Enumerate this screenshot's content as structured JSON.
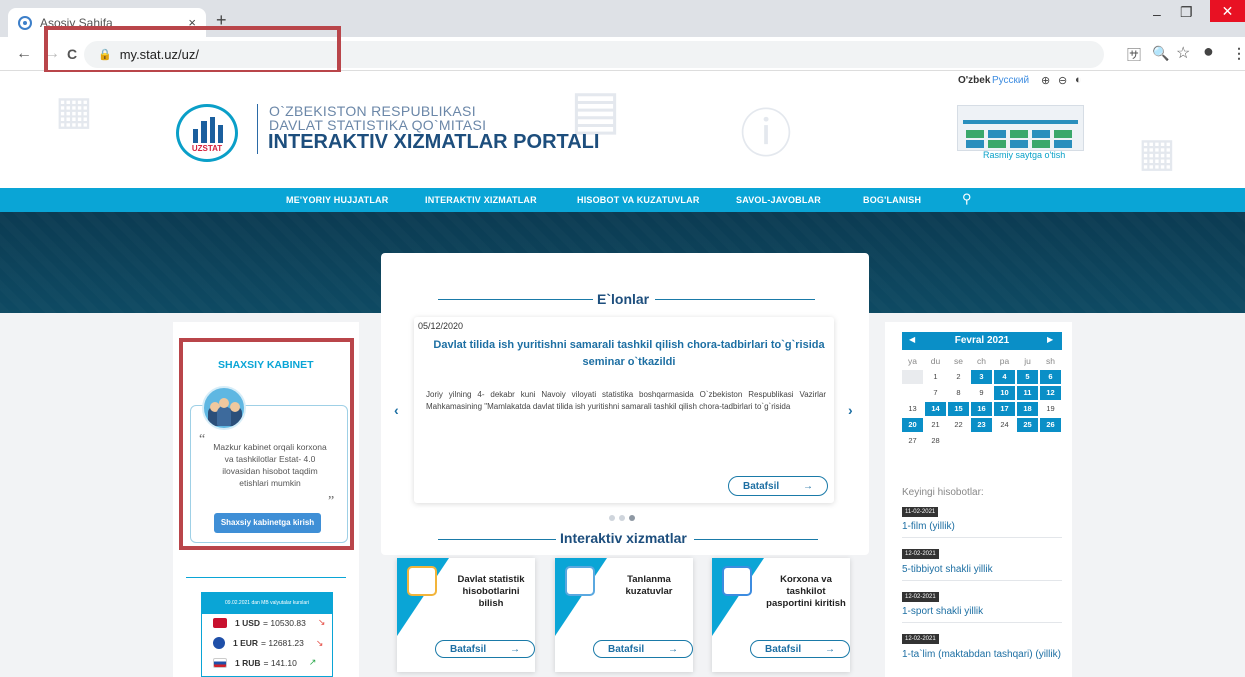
{
  "browser": {
    "tab_title": "Asosiy Sahifa",
    "tab_close": "×",
    "new_tab": "+",
    "url": "my.stat.uz/uz/",
    "win_min": "–",
    "win_max": "❐",
    "win_close": "✕",
    "back": "←",
    "forward": "→",
    "reload": "C",
    "lock": "🔒",
    "translate": "🈂",
    "zoom": "🔍",
    "star": "☆",
    "profile": "●",
    "menu": "⋮"
  },
  "header": {
    "logo_label": "UZSTAT",
    "line1": "O`ZBEKISTON RESPUBLIKASI",
    "line2": "DAVLAT STATISTIKA QO`MITASI",
    "line3": "INTERAKTIV XIZMATLAR PORTALI",
    "lang_uz": "O'zbek",
    "lang_ru": "Русский",
    "zoom_in": "⊕",
    "zoom_out": "⊖",
    "contrast": "◐",
    "official_link": "Rasmiy saytga o'tish"
  },
  "nav": {
    "items": [
      "ME'YORIY HUJJATLAR",
      "INTERAKTIV XIZMATLAR",
      "HISOBOT VA KUZATUVLAR",
      "SAVOL-JAVOBLAR",
      "BOG'LANISH"
    ],
    "search_icon": "⚲"
  },
  "cabinet": {
    "title": "SHAXSIY KABINET",
    "quote_open": "“",
    "quote_close": "”",
    "text": "Mazkur kabinet orqali korxona va tashkilotlar Estat- 4.0 ilovasidan hisobot taqdim etishlari mumkin",
    "button": "Shaxsiy kabinetga kirish"
  },
  "currency": {
    "header": "09.02.2021 dan MB valyutalar kurslari",
    "rows": [
      {
        "code": "1 USD",
        "rate": "= 10530.83",
        "trend": "↘",
        "trend_color": "#e4473f",
        "flag_color": "#c8102e"
      },
      {
        "code": "1 EUR",
        "rate": "= 12681.23",
        "trend": "↘",
        "trend_color": "#e4473f",
        "flag_color": "#1f4fa8"
      },
      {
        "code": "1 RUB",
        "rate": "= 141.10",
        "trend": "↗",
        "trend_color": "#2aa84a",
        "flag_color": "#d0202a"
      }
    ]
  },
  "announcements": {
    "title": "E`lonlar",
    "date": "05/12/2020",
    "headline": "Davlat tilida ish yuritishni samarali tashkil qilish chora-tadbirlari to`g`risida seminar o`tkazildi",
    "body": "Joriy yilning 4- dekabr kuni Navoiy viloyati statistika boshqarmasida O`zbekiston Respublikasi Vazirlar Mahkamasining \"Mamlakatda davlat tilida ish yuritishni samarali tashkil qilish chora-tadbirlari to`g`risida",
    "more": "Batafsil",
    "more_arrow": "→",
    "prev": "‹",
    "next": "›"
  },
  "services": {
    "title": "Interaktiv xizmatlar",
    "items": [
      {
        "label": "Davlat statistik hisobotlarini bilish",
        "more": "Batafsil",
        "arrow": "→"
      },
      {
        "label": "Tanlanma kuzatuvlar",
        "more": "Batafsil",
        "arrow": "→"
      },
      {
        "label": "Korxona va tashkilot pasportini kiritish",
        "more": "Batafsil",
        "arrow": "→"
      }
    ]
  },
  "calendar": {
    "month": "Fevral 2021",
    "prev": "◀",
    "next": "▶",
    "weekdays": [
      "ya",
      "du",
      "se",
      "ch",
      "pa",
      "ju",
      "sh"
    ],
    "weeks": [
      [
        {
          "d": "",
          "s": "gr"
        },
        {
          "d": "1",
          "s": ""
        },
        {
          "d": "2",
          "s": ""
        },
        {
          "d": "3",
          "s": "hl"
        },
        {
          "d": "4",
          "s": "hl"
        },
        {
          "d": "5",
          "s": "hl"
        },
        {
          "d": "6",
          "s": "hl"
        }
      ],
      [
        {
          "d": "",
          "s": ""
        },
        {
          "d": "7",
          "s": ""
        },
        {
          "d": "8",
          "s": ""
        },
        {
          "d": "9",
          "s": ""
        },
        {
          "d": "10",
          "s": "hl"
        },
        {
          "d": "11",
          "s": "hl"
        },
        {
          "d": "12",
          "s": "hl"
        }
      ],
      [
        {
          "d": "13",
          "s": ""
        },
        {
          "d": "14",
          "s": "hl"
        },
        {
          "d": "15",
          "s": "hl"
        },
        {
          "d": "16",
          "s": "hl"
        },
        {
          "d": "17",
          "s": "hl"
        },
        {
          "d": "18",
          "s": "hl"
        },
        {
          "d": "19",
          "s": ""
        }
      ],
      [
        {
          "d": "20",
          "s": "hl"
        },
        {
          "d": "21",
          "s": ""
        },
        {
          "d": "22",
          "s": ""
        },
        {
          "d": "23",
          "s": "hl"
        },
        {
          "d": "24",
          "s": ""
        },
        {
          "d": "25",
          "s": "hl"
        },
        {
          "d": "26",
          "s": "hl"
        }
      ],
      [
        {
          "d": "27",
          "s": ""
        },
        {
          "d": "28",
          "s": ""
        }
      ]
    ]
  },
  "reports": {
    "title": "Keyingi hisobotlar:",
    "items": [
      {
        "date": "11-02-2021",
        "name": "1-film (yillik)"
      },
      {
        "date": "12-02-2021",
        "name": "5-tibbiyot shakli yillik"
      },
      {
        "date": "12-02-2021",
        "name": "1-sport shakli yillik"
      },
      {
        "date": "12-02-2021",
        "name": "1-ta`lim (maktabdan tashqari) (yillik)"
      }
    ]
  },
  "colors": {
    "accent": "#0aa5d6",
    "dark_blue": "#1d4e7d",
    "highlight_red": "#b9454a"
  }
}
